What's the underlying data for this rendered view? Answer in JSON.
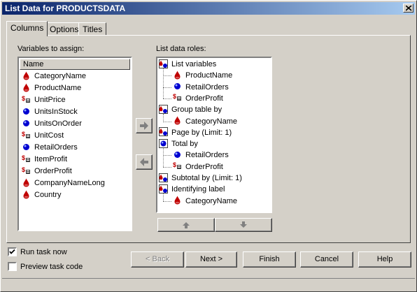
{
  "window": {
    "title": "List Data for PRODUCTSDATA"
  },
  "tabs": [
    {
      "label": "Columns",
      "active": true
    },
    {
      "label": "Options",
      "active": false
    },
    {
      "label": "Titles",
      "active": false
    }
  ],
  "variables": {
    "label": "Variables to assign:",
    "header": "Name",
    "items": [
      {
        "name": "CategoryName",
        "icon": "character-icon"
      },
      {
        "name": "ProductName",
        "icon": "character-icon"
      },
      {
        "name": "UnitPrice",
        "icon": "currency-icon"
      },
      {
        "name": "UnitsInStock",
        "icon": "numeric-icon"
      },
      {
        "name": "UnitsOnOrder",
        "icon": "numeric-icon"
      },
      {
        "name": "UnitCost",
        "icon": "currency-icon"
      },
      {
        "name": "RetailOrders",
        "icon": "numeric-icon"
      },
      {
        "name": "ItemProfit",
        "icon": "currency-icon"
      },
      {
        "name": "OrderProfit",
        "icon": "currency-icon"
      },
      {
        "name": "CompanyNameLong",
        "icon": "character-icon"
      },
      {
        "name": "Country",
        "icon": "character-icon"
      }
    ]
  },
  "roles": {
    "label": "List data roles:",
    "nodes": [
      {
        "text": "List variables",
        "level": 0,
        "icon": "role-icon"
      },
      {
        "text": "ProductName",
        "level": 1,
        "icon": "character-icon"
      },
      {
        "text": "RetailOrders",
        "level": 1,
        "icon": "numeric-icon"
      },
      {
        "text": "OrderProfit",
        "level": 1,
        "icon": "currency-icon"
      },
      {
        "text": "Group table by",
        "level": 0,
        "icon": "role-icon"
      },
      {
        "text": "CategoryName",
        "level": 1,
        "icon": "character-icon"
      },
      {
        "text": "Page by  (Limit: 1)",
        "level": 0,
        "icon": "role-icon"
      },
      {
        "text": "Total by",
        "level": 0,
        "icon": "numeric-role-icon"
      },
      {
        "text": "RetailOrders",
        "level": 1,
        "icon": "numeric-icon"
      },
      {
        "text": "OrderProfit",
        "level": 1,
        "icon": "currency-icon"
      },
      {
        "text": "Subtotal by  (Limit: 1)",
        "level": 0,
        "icon": "role-icon"
      },
      {
        "text": "Identifying label",
        "level": 0,
        "icon": "role-icon"
      },
      {
        "text": "CategoryName",
        "level": 1,
        "icon": "character-icon"
      }
    ]
  },
  "options": {
    "run_task_now": {
      "label": "Run task now",
      "checked": true
    },
    "preview_task_code": {
      "label": "Preview task code",
      "checked": false
    }
  },
  "buttons": {
    "back": "< Back",
    "next": "Next >",
    "finish": "Finish",
    "cancel": "Cancel",
    "help": "Help"
  },
  "colors": {
    "titlebar_start": "#0a246a",
    "titlebar_end": "#a6caf0",
    "face": "#d4d0c8",
    "character_icon": "#c00000",
    "numeric_icon": "#0000d0"
  }
}
